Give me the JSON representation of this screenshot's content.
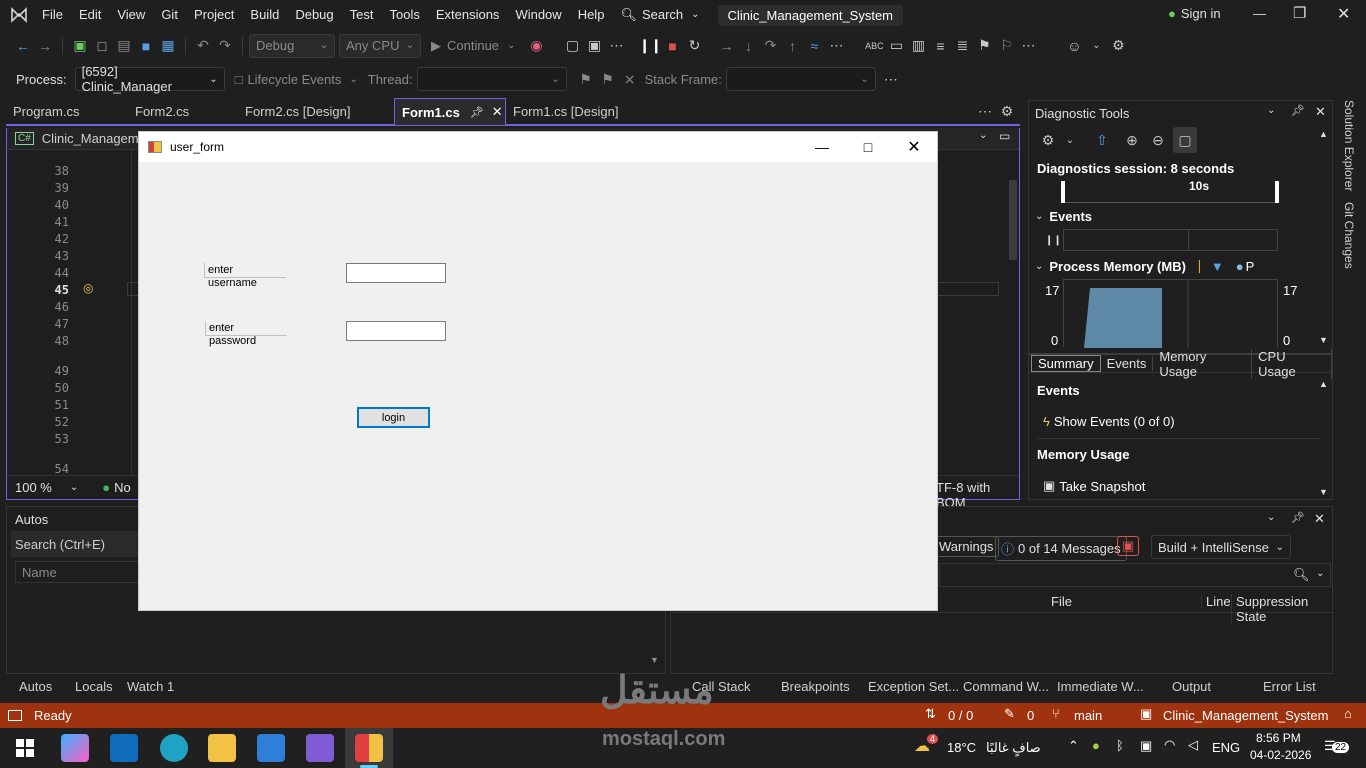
{
  "menu": [
    "File",
    "Edit",
    "View",
    "Git",
    "Project",
    "Build",
    "Debug",
    "Test",
    "Tools",
    "Extensions",
    "Window",
    "Help"
  ],
  "search_label": "Search",
  "solution_title": "Clinic_Management_System",
  "sign_in": "Sign in",
  "toolbar": {
    "config": "Debug",
    "platform": "Any CPU",
    "continue": "Continue"
  },
  "procbar": {
    "process_label": "Process:",
    "process_value": "[6592] Clinic_Manager",
    "lifecycle": "Lifecycle Events",
    "thread_label": "Thread:",
    "stack_label": "Stack Frame:"
  },
  "tabs": [
    "Program.cs",
    "Form2.cs",
    "Form2.cs [Design]",
    "Form1.cs",
    "Form1.cs [Design]"
  ],
  "active_tab": "Form1.cs",
  "editor": {
    "project_nav": "Clinic_Managemer",
    "zoom": "100 %",
    "status_left": "No",
    "encoding": "TF-8 with BOM"
  },
  "line_numbers": [
    "38",
    "39",
    "40",
    "41",
    "42",
    "43",
    "44",
    "45",
    "46",
    "47",
    "48",
    "49",
    "50",
    "51",
    "52",
    "53",
    "54"
  ],
  "diag": {
    "title": "Diagnostic Tools",
    "session": "Diagnostics session: 8 seconds",
    "tick": "10s",
    "events": "Events",
    "memory": "Process Memory (MB)",
    "p": "P",
    "max": "17",
    "min": "0",
    "subtabs": [
      "Summary",
      "Events",
      "Memory Usage",
      "CPU Usage"
    ],
    "events_header": "Events",
    "show_events": "Show Events (0 of 0)",
    "memory_usage": "Memory Usage",
    "snapshot": "Take Snapshot"
  },
  "rail": [
    "Solution Explorer",
    "Git Changes"
  ],
  "autos": {
    "title": "Autos",
    "search": "Search (Ctrl+E)",
    "col_name": "Name"
  },
  "errors": {
    "warnings": "Warnings",
    "messages": "0 of 14 Messages",
    "build": "Build + IntelliSense",
    "col_file": "File",
    "col_line": "Line",
    "col_supp": "Suppression State"
  },
  "bottom_tabs_left": [
    "Autos",
    "Locals",
    "Watch 1"
  ],
  "bottom_tabs_right": [
    "Call Stack",
    "Breakpoints",
    "Exception Set...",
    "Command W...",
    "Immediate W...",
    "Output",
    "Error List"
  ],
  "statusbar": {
    "ready": "Ready",
    "updown": "0 / 0",
    "pencil": "0",
    "branch": "main",
    "solution": "Clinic_Management_System",
    "bell": ""
  },
  "taskbar": {
    "temp": "18°C",
    "weather": "صافٍ غالبًا",
    "lang": "ENG",
    "time": "8:56 PM",
    "date": "04-02-2026",
    "badge": "22",
    "weather_badge": "4"
  },
  "watermark": {
    "arabic": "مستقل",
    "site": "mostaql.com"
  },
  "form": {
    "title": "user_form",
    "username_label": "enter username",
    "password_label": "enter password",
    "login": "login"
  },
  "colors": {
    "accent": "#7160e8",
    "statusbar": "#a0330f",
    "button_focus": "#0078d7"
  }
}
